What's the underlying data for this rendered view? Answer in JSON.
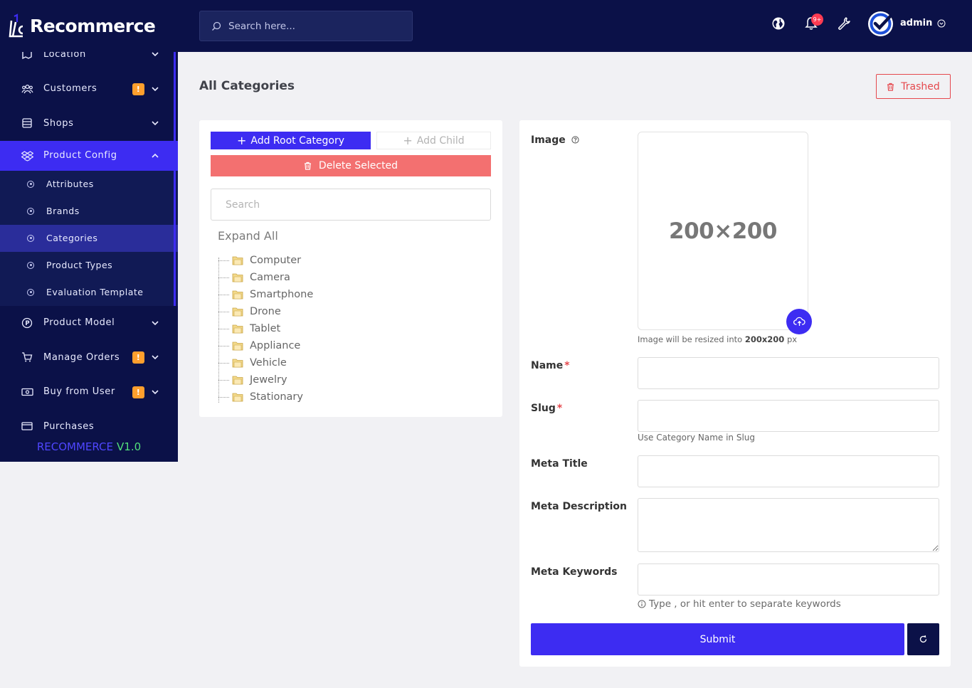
{
  "brand": {
    "name": "Recommerce"
  },
  "sidebar": {
    "items": [
      {
        "label": "Location"
      },
      {
        "label": "Customers",
        "badge": "!"
      },
      {
        "label": "Shops"
      },
      {
        "label": "Product Config"
      },
      {
        "label": "Product Model"
      },
      {
        "label": "Manage Orders",
        "badge": "!"
      },
      {
        "label": "Buy from User",
        "badge": "!"
      },
      {
        "label": "Purchases"
      }
    ],
    "sub_items": [
      {
        "label": "Attributes"
      },
      {
        "label": "Brands"
      },
      {
        "label": "Categories"
      },
      {
        "label": "Product Types"
      },
      {
        "label": "Evaluation Template"
      }
    ],
    "footer": {
      "name": "RECOMMERCE",
      "version": "V1.0"
    }
  },
  "topbar": {
    "search_placeholder": "Search here...",
    "notification_count": "9+",
    "user_name": "admin"
  },
  "page": {
    "title": "All Categories",
    "trashed_label": "Trashed"
  },
  "tree_panel": {
    "add_root_label": "Add Root Category",
    "add_child_label": "Add Child",
    "delete_label": "Delete Selected",
    "search_placeholder": "Search",
    "expand_all_label": "Expand All",
    "nodes": [
      "Computer",
      "Camera",
      "Smartphone",
      "Drone",
      "Tablet",
      "Appliance",
      "Vehicle",
      "Jewelry",
      "Stationary"
    ]
  },
  "form": {
    "image_label": "Image",
    "image_placeholder": "200×200",
    "image_hint_prefix": "Image will be resized into",
    "image_hint_size": "200x200",
    "image_hint_unit": "px",
    "name_label": "Name",
    "slug_label": "Slug",
    "slug_hint": "Use Category Name in Slug",
    "meta_title_label": "Meta Title",
    "meta_description_label": "Meta Description",
    "meta_keywords_label": "Meta Keywords",
    "keywords_hint": "Type , or hit enter to separate keywords",
    "required_mark": "*",
    "submit_label": "Submit"
  },
  "colors": {
    "sidebar_bg": "#0b1148",
    "accent": "#3d2cf2",
    "danger": "#e5484d",
    "badge": "#ff9f2d"
  }
}
